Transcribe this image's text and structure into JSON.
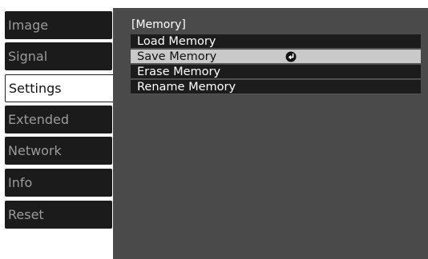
{
  "sidebar": {
    "items": [
      {
        "label": "Image"
      },
      {
        "label": "Signal"
      },
      {
        "label": "Settings"
      },
      {
        "label": "Extended"
      },
      {
        "label": "Network"
      },
      {
        "label": "Info"
      },
      {
        "label": "Reset"
      }
    ],
    "active_index": 2
  },
  "panel": {
    "title": "[Memory]",
    "items": [
      {
        "label": "Load Memory"
      },
      {
        "label": "Save Memory",
        "icon": "enter-icon"
      },
      {
        "label": "Erase Memory"
      },
      {
        "label": "Rename Memory"
      }
    ],
    "selected_index": 1
  },
  "colors": {
    "panel_bg": "#4a4a4a",
    "sidebar_bg": "#1b1b1b",
    "sidebar_active_bg": "#ffffff",
    "menu_item_bg": "#1c1c1c",
    "menu_selected_bg": "#c9c9c9"
  }
}
